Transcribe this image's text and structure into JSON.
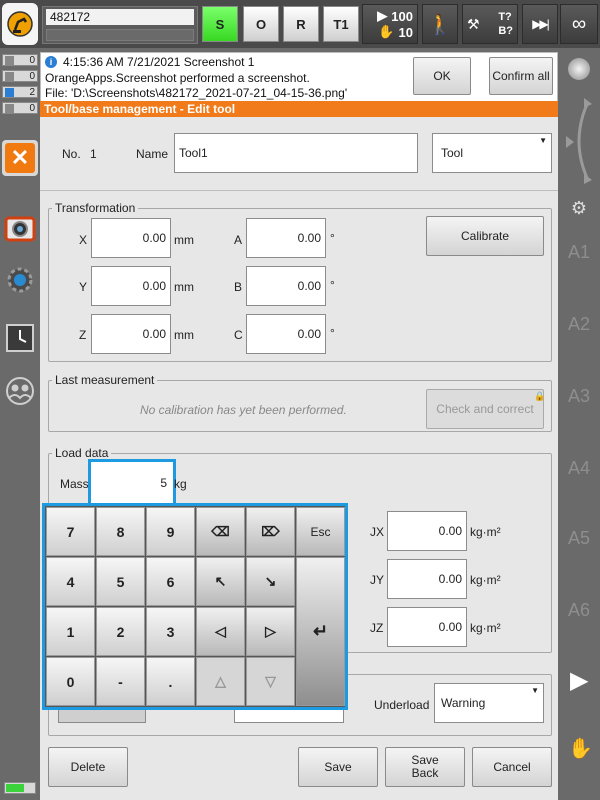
{
  "topbar": {
    "robot_id": "482172",
    "mode_s": "S",
    "mode_o": "O",
    "mode_r": "R",
    "mode_t1": "T1",
    "override_run": "100",
    "override_jog": "10",
    "tool_base_t": "T?",
    "tool_base_b": "B?",
    "infinity": "∞"
  },
  "leftbar": {
    "counters": [
      {
        "icon": "error-icon",
        "value": "0",
        "color": "#9a9a9a"
      },
      {
        "icon": "warning-icon",
        "value": "0",
        "color": "#9a9a9a"
      },
      {
        "icon": "info-icon",
        "value": "2",
        "color": "#2a7fd4"
      },
      {
        "icon": "wait-icon",
        "value": "0",
        "color": "#9a9a9a"
      }
    ]
  },
  "message": {
    "line1": "4:15:36 AM 7/21/2021 Screenshot 1",
    "line2": "OrangeApps.Screenshot performed a screenshot.",
    "line3": "File: 'D:\\Screenshots\\482172_2021-07-21_04-15-36.png'",
    "ok_label": "OK",
    "confirm_all_label": "Confirm all"
  },
  "title": "Tool/base management - Edit tool",
  "tool": {
    "no_label": "No.",
    "no_value": "1",
    "name_label": "Name",
    "name_value": "Tool1",
    "type_value": "Tool"
  },
  "transformation": {
    "title": "Transformation",
    "x_label": "X",
    "x_value": "0.00",
    "y_label": "Y",
    "y_value": "0.00",
    "z_label": "Z",
    "z_value": "0.00",
    "a_label": "A",
    "a_value": "0.00",
    "b_label": "B",
    "b_value": "0.00",
    "c_label": "C",
    "c_value": "0.00",
    "unit_mm": "mm",
    "unit_deg": "°",
    "calibrate_label": "Calibrate"
  },
  "last_measurement": {
    "title": "Last measurement",
    "text": "No calibration has yet been performed.",
    "check_label": "Check and correct"
  },
  "load_data": {
    "title": "Load data",
    "mass_label": "Mass",
    "mass_value": "5",
    "mass_unit": "kg",
    "jx_label": "JX",
    "jx_value": "0.00",
    "jy_label": "JY",
    "jy_value": "0.00",
    "jz_label": "JZ",
    "jz_value": "0.00",
    "inertia_unit": "kg·m²"
  },
  "underload": {
    "label": "Underload",
    "value": "Warning"
  },
  "keypad": {
    "k7": "7",
    "k8": "8",
    "k9": "9",
    "esc": "Esc",
    "k4": "4",
    "k5": "5",
    "k6": "6",
    "k1": "1",
    "k2": "2",
    "k3": "3",
    "k0": "0",
    "minus": "-",
    "dot": "."
  },
  "footer": {
    "delete_label": "Delete",
    "save_label": "Save",
    "save_back_line1": "Save",
    "save_back_line2": "Back",
    "cancel_label": "Cancel"
  },
  "rightbar": {
    "axes": [
      "A1",
      "A2",
      "A3",
      "A4",
      "A5",
      "A6"
    ]
  }
}
